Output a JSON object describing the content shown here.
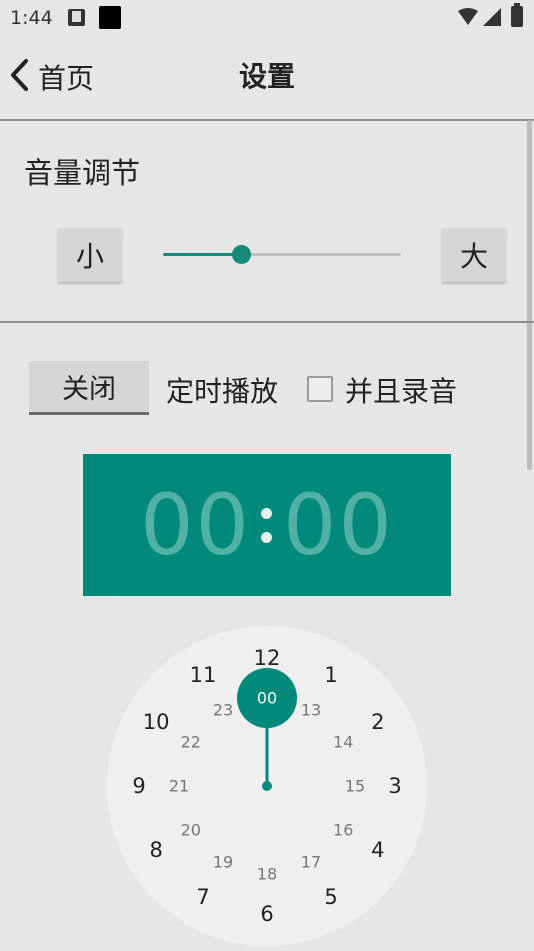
{
  "status_bar": {
    "time": "1:44"
  },
  "header": {
    "back_label": "首页",
    "title": "设置"
  },
  "volume": {
    "title": "音量调节",
    "down_label": "小",
    "up_label": "大",
    "level": 0.33
  },
  "timer": {
    "toggle_label": "关闭",
    "timed_play_label": "定时播放",
    "record_label": "并且录音",
    "record_checked": false,
    "hours": "00",
    "minutes": "00"
  },
  "clock": {
    "outer_numbers": [
      "12",
      "1",
      "2",
      "3",
      "4",
      "5",
      "6",
      "7",
      "8",
      "9",
      "10",
      "11"
    ],
    "inner_numbers": [
      "00",
      "13",
      "14",
      "15",
      "16",
      "17",
      "18",
      "19",
      "20",
      "21",
      "22",
      "23"
    ],
    "selected": "00"
  },
  "colors": {
    "accent": "#018a79",
    "accent_light": "#148a79",
    "background": "#e6e6e6"
  }
}
